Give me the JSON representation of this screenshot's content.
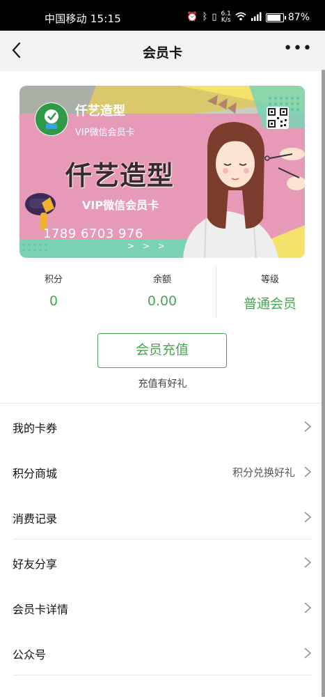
{
  "status_bar": {
    "carrier_time": "中国移动 15:15",
    "net_speed_value": "6.1",
    "net_speed_unit": "K/s",
    "battery": "87%",
    "battery_level": 0.87
  },
  "nav": {
    "title": "会员卡"
  },
  "card": {
    "shop_name": "仟艺造型",
    "shop_subtitle": "VIP微信会员卡",
    "big_title": "仟艺造型",
    "big_subtitle": "VIP微信会员卡",
    "card_number": "1789 6703 976",
    "arrows": "> > >",
    "colors": {
      "pink": "#e79ab7",
      "teal": "#79d3b4",
      "yellow": "#f5e26b",
      "grey": "#aab0a6"
    }
  },
  "stats": [
    {
      "label": "积分",
      "value": "0"
    },
    {
      "label": "余额",
      "value": "0.00"
    },
    {
      "label": "等级",
      "value": "普通会员"
    }
  ],
  "recharge": {
    "button_label": "会员充值",
    "tip": "充值有好礼"
  },
  "menu": [
    {
      "label": "我的卡券",
      "extra": "",
      "icon": "chevron-right-icon"
    },
    {
      "label": "积分商城",
      "extra": "积分兑换好礼",
      "icon": "chevron-right-icon"
    },
    {
      "label": "消费记录",
      "extra": "",
      "icon": "chevron-right-icon"
    },
    {
      "label": "好友分享",
      "extra": "",
      "icon": "chevron-right-icon"
    },
    {
      "label": "会员卡详情",
      "extra": "",
      "icon": "chevron-right-icon"
    },
    {
      "label": "公众号",
      "extra": "",
      "icon": "chevron-right-icon"
    }
  ],
  "accent_color": "#4aa552"
}
